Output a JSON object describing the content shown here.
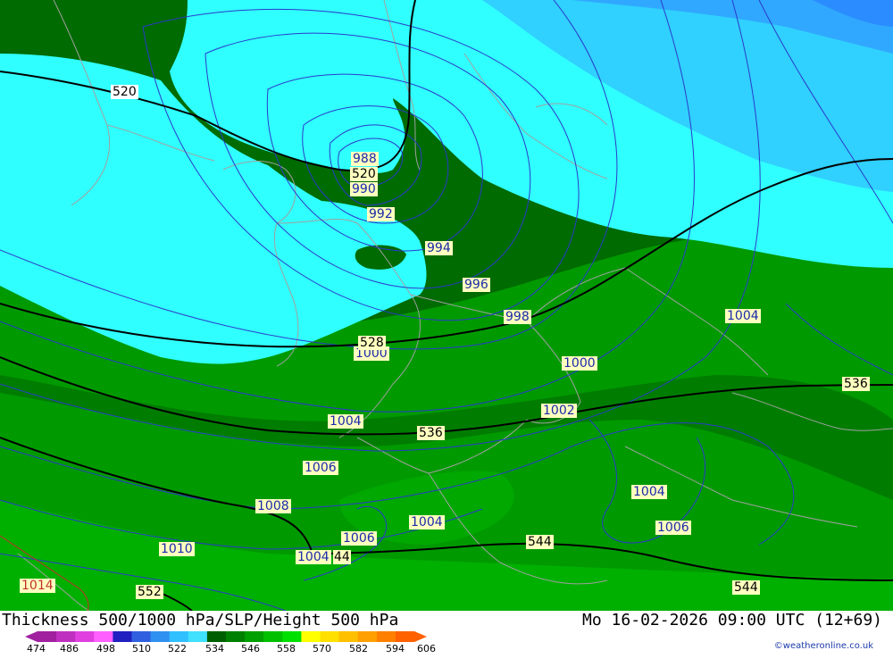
{
  "title": "Thickness 500/1000 hPa/SLP/Height 500 hPa",
  "datetime": "Mo 16-02-2026 09:00 UTC (12+69)",
  "credit": "©weatheronline.co.uk",
  "legend": {
    "labels": [
      "474",
      "486",
      "498",
      "510",
      "522",
      "534",
      "546",
      "558",
      "570",
      "582",
      "594",
      "606"
    ],
    "colors": [
      "#a020a0",
      "#c030c0",
      "#e040e0",
      "#ff60ff",
      "#2020c0",
      "#3060e0",
      "#3090f0",
      "#30c0ff",
      "#40e0ff",
      "#006000",
      "#008000",
      "#00a000",
      "#00c000",
      "#00e000",
      "#ffff00",
      "#ffe000",
      "#ffc000",
      "#ffa000",
      "#ff8000",
      "#ff6000"
    ]
  },
  "map_labels": {
    "slp": [
      "988",
      "990",
      "992",
      "994",
      "996",
      "998",
      "1000",
      "1000",
      "1002",
      "1004",
      "1004",
      "1004",
      "1004",
      "1006",
      "1006",
      "1006",
      "1008",
      "1010",
      "1014",
      "1004"
    ],
    "height": [
      "520",
      "520",
      "528",
      "536",
      "536",
      "544",
      "544",
      "552",
      "44"
    ]
  },
  "colors": {
    "dark_green": "#006b00",
    "green": "#009a00",
    "light_green": "#00b800",
    "cyan": "#30ffff",
    "sky": "#30d0ff",
    "blue": "#30a8ff",
    "isobar": "#2a3acc",
    "height_line": "#000000",
    "border": "#9a9a9a"
  }
}
